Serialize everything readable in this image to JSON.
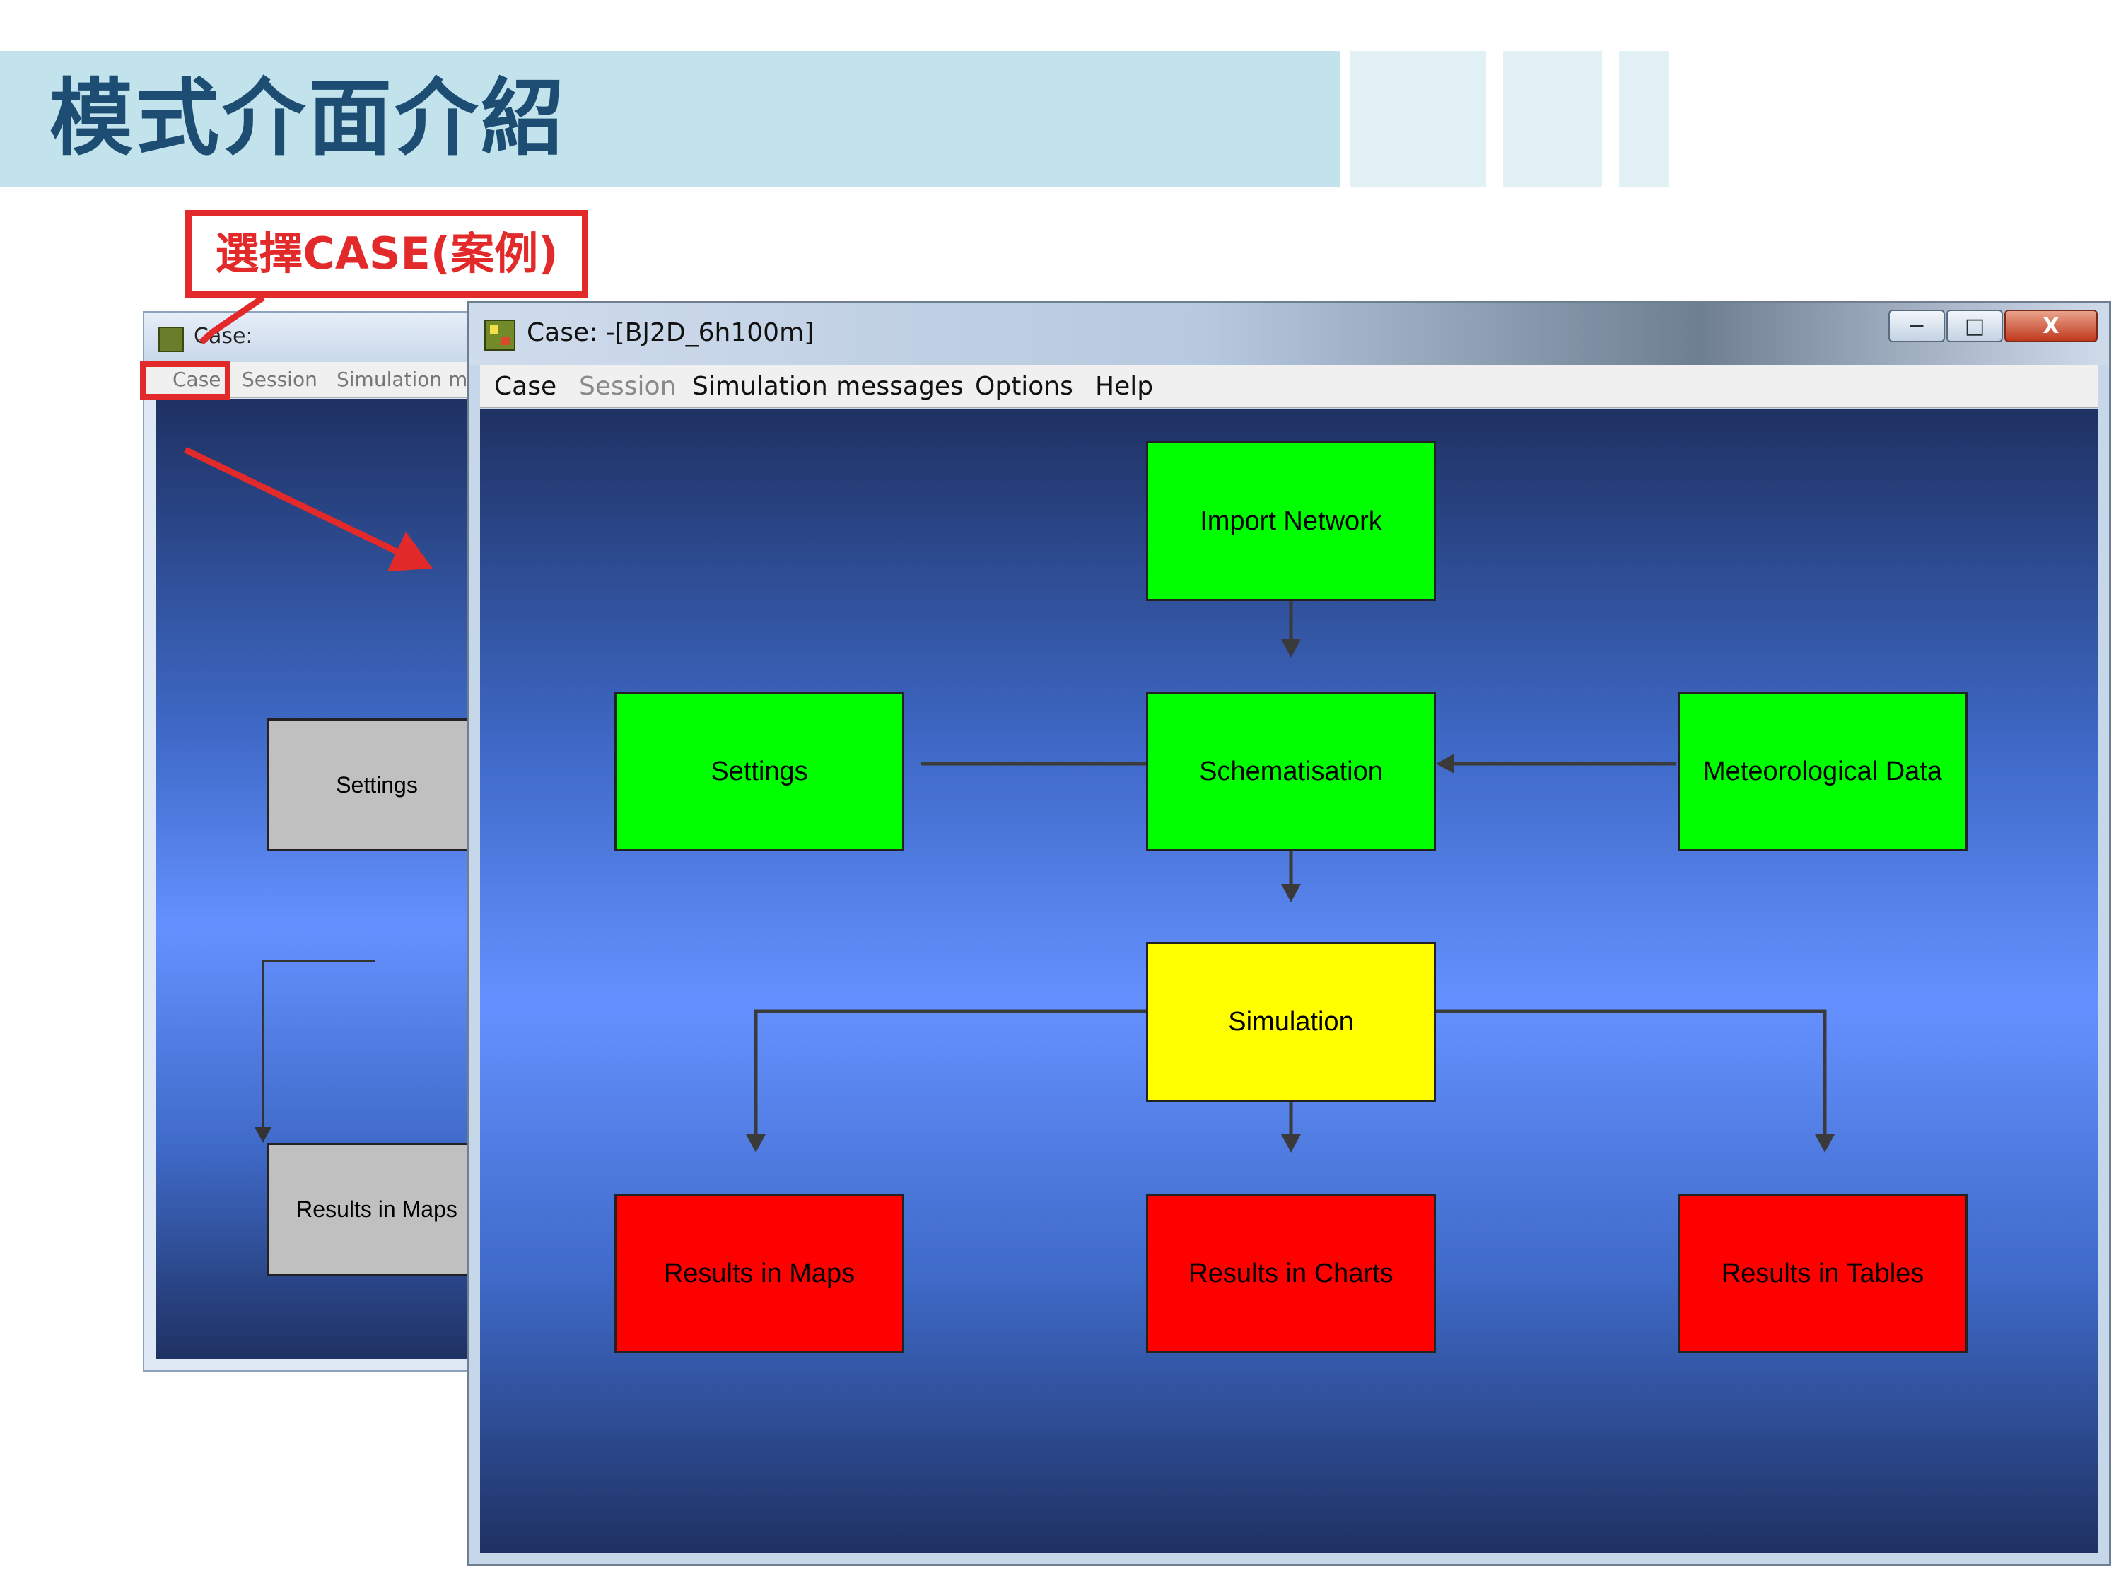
{
  "slide": {
    "title": "模式介面介紹",
    "callout": "選擇CASE(案例)"
  },
  "colors": {
    "header_band": "#c2e2ec",
    "title_text": "#1d4d72",
    "callout_red": "#e32a2a",
    "node_done": "#00ff00",
    "node_current": "#ffff00",
    "node_pending": "#ff0000",
    "node_inactive": "#c0c0c0"
  },
  "background_window": {
    "title": "Case:",
    "menu": [
      "Case",
      "Session",
      "Simulation m"
    ],
    "boxes": {
      "settings": "Settings",
      "results_maps": "Results in Maps"
    }
  },
  "main_window": {
    "title": "Case: -[BJ2D_6h100m]",
    "buttons": {
      "minimize": "─",
      "maximize": "□",
      "close": "X"
    },
    "menu": {
      "case": "Case",
      "session": "Session",
      "simulation_messages": "Simulation messages",
      "options": "Options",
      "help": "Help"
    },
    "nodes": {
      "import_network": "Import Network",
      "settings": "Settings",
      "schematisation": "Schematisation",
      "meteorological_data": "Meteorological Data",
      "simulation": "Simulation",
      "results_maps": "Results in Maps",
      "results_charts": "Results in Charts",
      "results_tables": "Results in Tables"
    }
  }
}
